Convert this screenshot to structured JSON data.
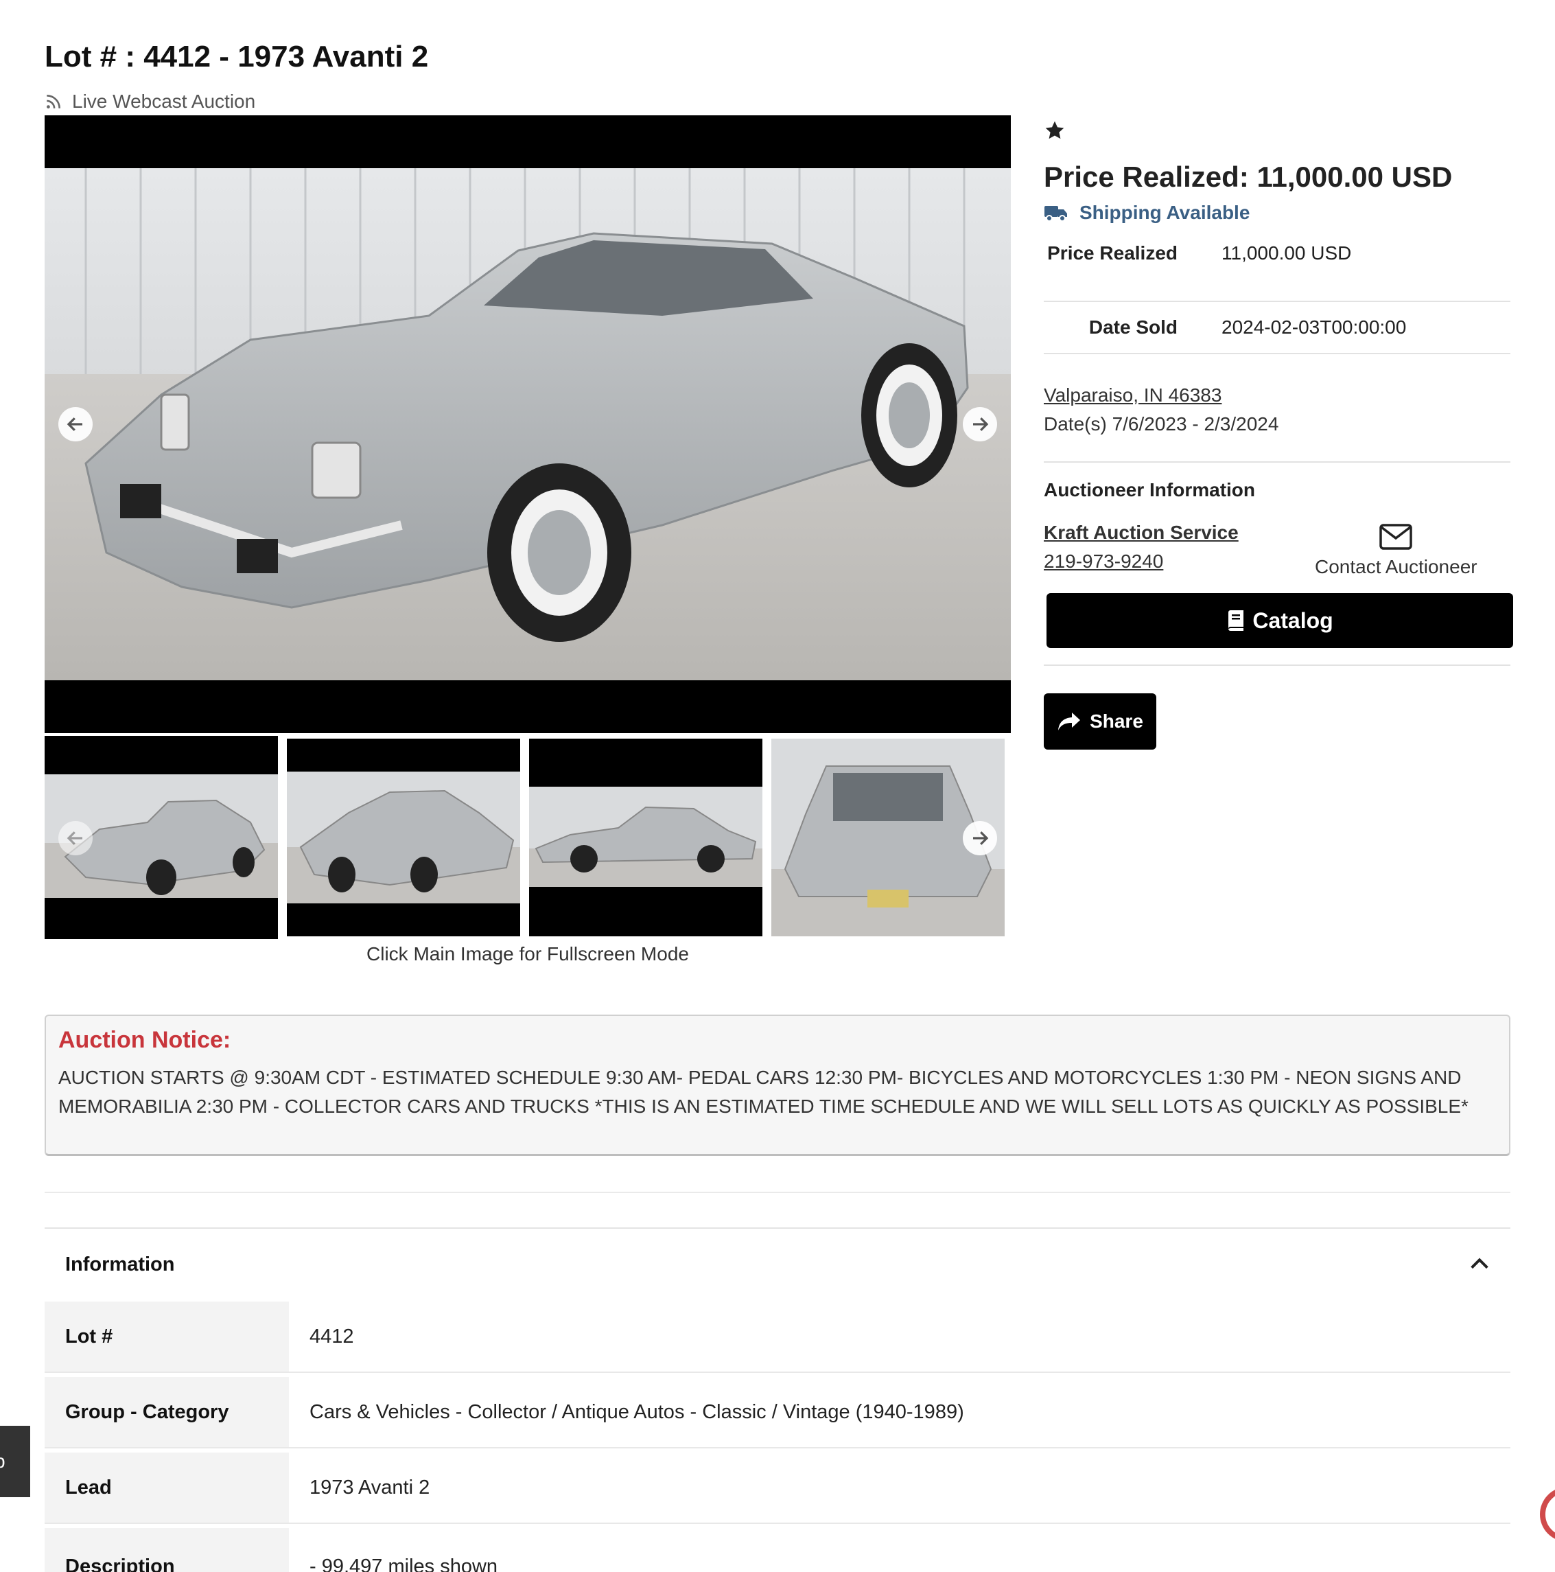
{
  "page": {
    "title": "Lot # : 4412 - 1973 Avanti 2",
    "auction_type": "Live Webcast Auction",
    "fullscreen_hint": "Click Main Image for Fullscreen Mode"
  },
  "pricing": {
    "headline": "Price Realized: 11,000.00 USD",
    "shipping": "Shipping Available",
    "details": [
      {
        "label": "Price Realized",
        "value": "11,000.00 USD"
      },
      {
        "label": "Date Sold",
        "value": "2024-02-03T00:00:00"
      }
    ]
  },
  "location": {
    "address": "Valparaiso, IN 46383",
    "dates": "Date(s) 7/6/2023 - 2/3/2024"
  },
  "auctioneer": {
    "heading": "Auctioneer Information",
    "name": "Kraft Auction Service",
    "phone": "219-973-9240",
    "contact_label": "Contact Auctioneer"
  },
  "buttons": {
    "catalog": "Catalog",
    "share": "Share"
  },
  "notice": {
    "title": "Auction Notice:",
    "text": "AUCTION STARTS @ 9:30AM CDT - ESTIMATED SCHEDULE 9:30 AM- PEDAL CARS 12:30 PM- BICYCLES AND MOTORCYCLES 1:30 PM - NEON SIGNS AND MEMORABILIA 2:30 PM - COLLECTOR CARS AND TRUCKS *THIS IS AN ESTIMATED TIME SCHEDULE AND WE WILL SELL LOTS AS QUICKLY AS POSSIBLE*"
  },
  "information": {
    "heading": "Information",
    "rows": [
      {
        "label": "Lot #",
        "value": "4412"
      },
      {
        "label": "Group - Category",
        "value": "Cars & Vehicles - Collector / Antique Autos - Classic / Vintage (1940-1989)"
      },
      {
        "label": "Lead",
        "value": "1973 Avanti 2"
      },
      {
        "label": "Description",
        "value": "- 99,497 miles shown"
      }
    ]
  },
  "colors": {
    "notice_title": "#c8353b",
    "shipping": "#3a5f84",
    "button_bg": "#000000"
  },
  "icons": [
    "rss-icon",
    "star-icon",
    "truck-icon",
    "envelope-icon",
    "book-icon",
    "share-icon",
    "arrow-left-icon",
    "arrow-right-icon",
    "chevron-up-icon"
  ]
}
